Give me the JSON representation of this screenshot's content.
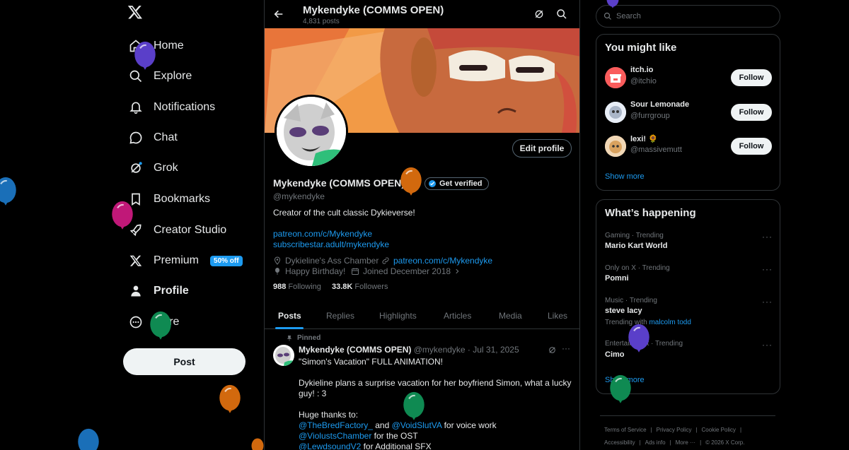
{
  "nav": {
    "items": [
      {
        "label": "Home",
        "icon": "home-icon"
      },
      {
        "label": "Explore",
        "icon": "search-icon"
      },
      {
        "label": "Notifications",
        "icon": "bell-icon"
      },
      {
        "label": "Chat",
        "icon": "chat-icon"
      },
      {
        "label": "Grok",
        "icon": "grok-icon"
      },
      {
        "label": "Bookmarks",
        "icon": "bookmark-icon"
      },
      {
        "label": "Creator Studio",
        "icon": "rocket-icon"
      },
      {
        "label": "Premium",
        "icon": "x-icon"
      },
      {
        "label": "Profile",
        "icon": "person-icon"
      },
      {
        "label": "More",
        "icon": "more-circle-icon"
      }
    ],
    "premium_badge": "50% off",
    "post_label": "Post"
  },
  "header": {
    "title": "Mykendyke (COMMS OPEN)",
    "post_count": "4,831 posts"
  },
  "profile": {
    "name": "Mykendyke (COMMS OPEN)",
    "handle": "@mykendyke",
    "get_verified": "Get verified",
    "edit_profile": "Edit profile",
    "bio": "Creator of the cult classic Dykieverse!",
    "links": [
      "patreon.com/c/Mykendyke",
      "subscribestar.adult/mykendyke"
    ],
    "location": "Dykieline's Ass Chamber",
    "website": "patreon.com/c/Mykendyke",
    "birthday": "Happy Birthday!",
    "joined": "Joined December 2018",
    "following_count": "988",
    "following_label": "Following",
    "followers_count": "33.8K",
    "followers_label": "Followers"
  },
  "tabs": [
    "Posts",
    "Replies",
    "Highlights",
    "Articles",
    "Media",
    "Likes"
  ],
  "pinned_post": {
    "pinned_label": "Pinned",
    "author": "Mykendyke (COMMS OPEN)",
    "handle_date": "@mykendyke · Jul 31, 2025",
    "line1": "\"Simon's Vacation\" FULL ANIMATION!",
    "line2": "Dykieline plans a surprise vacation for her boyfriend Simon, what a lucky",
    "line3": "guy! : 3",
    "line4": "Huge thanks to:",
    "credit1_a": "@TheBredFactory_",
    "credit1_b": " and ",
    "credit1_c": "@VoidSlutVA",
    "credit1_d": " for voice work",
    "credit2_a": "@ViolustsChamber",
    "credit2_b": " for the OST",
    "credit3_a": "@LewdsoundV2",
    "credit3_b": " for Additional SFX"
  },
  "right": {
    "search_placeholder": "Search",
    "you_might_like": "You might like",
    "suggestions": [
      {
        "name": "itch.io",
        "handle": "@itchio",
        "button": "Follow"
      },
      {
        "name": "Sour Lemonade",
        "handle": "@furrgroup",
        "button": "Follow"
      },
      {
        "name": "lexi! 🌻",
        "handle": "@massivemutt",
        "button": "Follow"
      }
    ],
    "show_more": "Show more",
    "whats_happening": "What’s happening",
    "trends": [
      {
        "context": "Gaming · Trending",
        "name": "Mario Kart World"
      },
      {
        "context": "Only on X · Trending",
        "name": "Pomni"
      },
      {
        "context": "Music · Trending",
        "name": "steve lacy",
        "extra_prefix": "Trending with ",
        "extra_link": "malcolm todd"
      },
      {
        "context": "Entertainment · Trending",
        "name": "Cimo"
      }
    ],
    "show_more_2": "Show more",
    "footer": {
      "terms": "Terms of Service",
      "privacy": "Privacy Policy",
      "cookie": "Cookie Policy",
      "accessibility": "Accessibility",
      "ads": "Ads info",
      "more": "More ···",
      "copyright": "© 2026 X Corp."
    }
  },
  "colors": {
    "background": "#000000",
    "accent": "#1d9bf0",
    "text": "#e7e9ea",
    "muted": "#71767b",
    "border": "#2f3336"
  }
}
